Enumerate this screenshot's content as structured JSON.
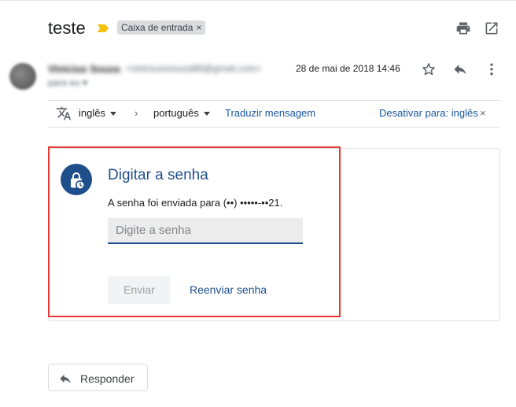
{
  "subject": "teste",
  "label_chip": {
    "text": "Caixa de entrada",
    "remove": "×"
  },
  "sender": {
    "name": "Vinicius Souza",
    "email": "<viniciusesouza86@gmail.com>",
    "to_line": "para eu ▾",
    "date": "28 de mai de 2018 14:46"
  },
  "translate_bar": {
    "source_lang": "inglês",
    "arrow": "›",
    "target_lang": "português",
    "translate_link": "Traduzir mensagem",
    "disable_link": "Desativar para: inglês",
    "close": "×"
  },
  "card": {
    "title": "Digitar a senha",
    "description": "A senha foi enviada para (••) •••••-••21.",
    "input_placeholder": "Digite a senha",
    "send_label": "Enviar",
    "resend_label": "Reenviar senha"
  },
  "reply": {
    "label": "Responder"
  },
  "colors": {
    "accent": "#1f4f8b",
    "link": "#1a56a0",
    "highlight": "#e53935",
    "importance": "#f4c20d"
  },
  "icons": [
    "importance-marker-icon",
    "print-icon",
    "open-new-window-icon",
    "star-icon",
    "reply-icon",
    "more-vert-icon",
    "translate-icon",
    "lock-clock-icon"
  ]
}
